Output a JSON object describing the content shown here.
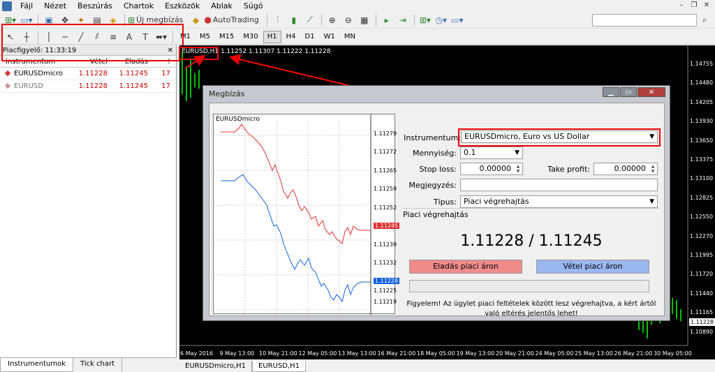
{
  "menu": [
    "Fájl",
    "Nézet",
    "Beszúrás",
    "Chartok",
    "Eszközök",
    "Ablak",
    "Súgó"
  ],
  "toolbar": {
    "new_order": "Új megbízás",
    "autotrading": "AutoTrading"
  },
  "timeframes": [
    {
      "label": "M1",
      "active": false
    },
    {
      "label": "M5",
      "active": false
    },
    {
      "label": "M15",
      "active": false
    },
    {
      "label": "M30",
      "active": false
    },
    {
      "label": "H1",
      "active": true
    },
    {
      "label": "H4",
      "active": false
    },
    {
      "label": "D1",
      "active": false
    },
    {
      "label": "W1",
      "active": false
    },
    {
      "label": "MN",
      "active": false
    }
  ],
  "market_watch": {
    "title": "Piacfigyelő: 11:33:19",
    "columns": [
      "Instrumentum",
      "Vétel",
      "Eladás",
      "!"
    ],
    "rows": [
      {
        "symbol": "EURUSDmicro",
        "bid": "1.11228",
        "ask": "1.11245",
        "spread": "17"
      },
      {
        "symbol": "EURUSD",
        "bid": "1.11228",
        "ask": "1.11245",
        "spread": "17"
      }
    ],
    "tabs": [
      "Instrumentumok",
      "Tick chart"
    ]
  },
  "chart": {
    "title": "EURUSD,H1  1.11252 1.11307 1.11222 1.11228",
    "price_labels": [
      "1.14755",
      "1.14480",
      "1.14205",
      "1.13930",
      "1.13650",
      "1.13375",
      "1.13100",
      "1.12825",
      "1.12550",
      "1.12270",
      "1.11995",
      "1.11720",
      "1.11440",
      "1.11165",
      "1.10890"
    ],
    "current_price": "1.11228",
    "time_labels": [
      "6 May 2016",
      "9 May 13:00",
      "10 May 21:00",
      "12 May 05:00",
      "13 May 13:00",
      "16 May 21:00",
      "18 May 05:00",
      "19 May 13:00",
      "20 May 21:00",
      "24 May 05:00",
      "25 May 13:00",
      "26 May 21:00",
      "30 May 05:00"
    ],
    "tabs": [
      "EURUSDmicro,H1",
      "EURUSD,H1"
    ]
  },
  "dialog": {
    "title": "Megbízás",
    "mini_chart": {
      "title": "EURUSDmicro",
      "labels": [
        "1.11279",
        "1.11272",
        "1.11265",
        "1.11259",
        "1.11252",
        "1.11245",
        "1.11239",
        "1.11232",
        "1.11225",
        "1.11219"
      ],
      "ask_label": "1.11245",
      "bid_label": "1.11228"
    },
    "instrument_label": "Instrumentum:",
    "instrument_value": "EURUSDmicro, Euro vs US Dollar",
    "volume_label": "Mennyiség:",
    "volume_value": "0.1",
    "sl_label": "Stop loss:",
    "sl_value": "0.00000",
    "tp_label": "Take profit:",
    "tp_value": "0.00000",
    "comment_label": "Megjegyzés:",
    "comment_value": "",
    "type_label": "Típus:",
    "type_value": "Piaci végrehajtás",
    "exec_title": "Piaci végrehajtás",
    "quote": "1.11228 / 1.11245",
    "sell_button": "Eladás piaci áron",
    "buy_button": "Vétel piaci áron",
    "warning": "Figyelem! Az ügylet piaci feltételek között lesz végrehajtva, a kért ártól való eltérés jelentős lehet!"
  },
  "colors": {
    "sell": "#f08b8b",
    "buy": "#9ab7f0",
    "highlight": "#e00000",
    "ask_line": "#e03030",
    "bid_line": "#1060e0",
    "candles": "#00c000"
  }
}
